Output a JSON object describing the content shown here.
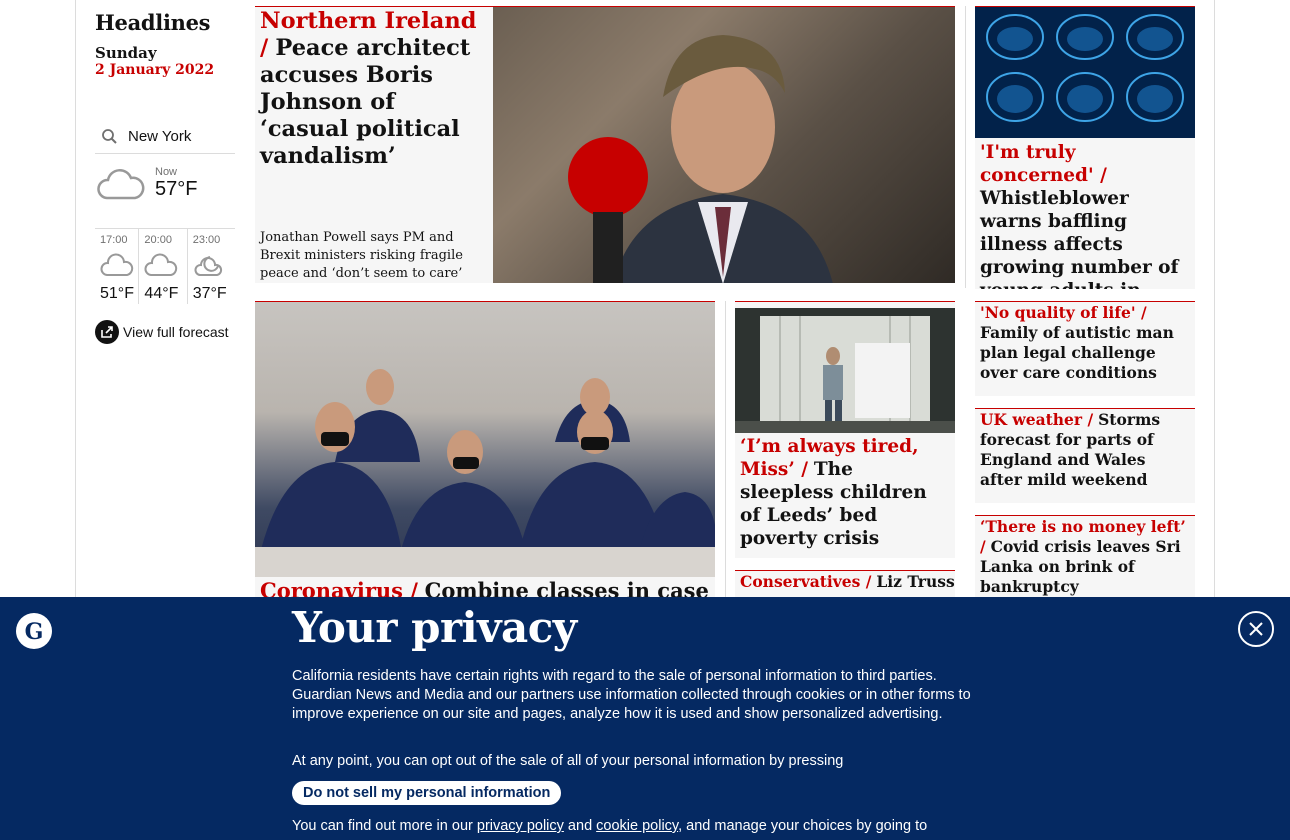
{
  "rail": {
    "title": "Headlines",
    "day": "Sunday",
    "date": "2 January 2022",
    "weather": {
      "location": "New York",
      "now_label": "Now",
      "now_temp": "57°F",
      "forecast": [
        {
          "time": "17:00",
          "temp": "51°F",
          "icon": "cloud-icon"
        },
        {
          "time": "20:00",
          "temp": "44°F",
          "icon": "cloud-icon"
        },
        {
          "time": "23:00",
          "temp": "37°F",
          "icon": "moon-cloud-icon"
        }
      ],
      "full_forecast": "View full forecast"
    }
  },
  "stories": {
    "ni": {
      "kicker": "Northern Ireland /",
      "headline": "Peace architect accuses Boris Johnson of ‘casual political vandalism’",
      "standfirst": "Jonathan Powell says PM and Brexit ministers risking fragile peace and ‘don’t seem to care’"
    },
    "whistle": {
      "kicker": "'I'm truly concerned' /",
      "headline": "Whistleblower warns baffling illness affects growing number of young adults in Canadian province"
    },
    "autistic": {
      "kicker": "'No quality of life' /",
      "headline": "Family of autistic man plan legal challenge over care conditions"
    },
    "weather": {
      "kicker": "UK weather /",
      "headline": "Storms forecast for parts of England and Wales after mild weekend"
    },
    "lanka": {
      "kicker": "‘There is no money left’ /",
      "headline": "Covid crisis leaves Sri Lanka on brink of bankruptcy"
    },
    "leeds": {
      "kicker": "‘I’m always tired, Miss’ /",
      "headline": "The sleepless children of Leeds’ bed poverty crisis"
    },
    "truss": {
      "kicker": "Conservatives /",
      "headline": "Liz Truss"
    },
    "covid": {
      "kicker": "Coronavirus /",
      "headline": "Combine classes in case of"
    }
  },
  "privacy": {
    "title": "Your privacy",
    "p1": "California residents have certain rights with regard to the sale of personal information to third parties. Guardian News and Media and our partners use information collected through cookies or in other forms to improve experience on our site and pages, analyze how it is used and show personalized advertising.",
    "p2": "At any point, you can opt out of the sale of all of your personal information by pressing",
    "button": "Do not sell my personal information",
    "p3_start": "You can find out more in our ",
    "privacy_link": "privacy policy",
    "p3_and": " and ",
    "cookie_link": "cookie policy",
    "p3_end": ", and manage your choices by going to"
  },
  "colors": {
    "accent": "#c70000",
    "banner": "#052962",
    "card_bg": "#f6f6f6"
  }
}
